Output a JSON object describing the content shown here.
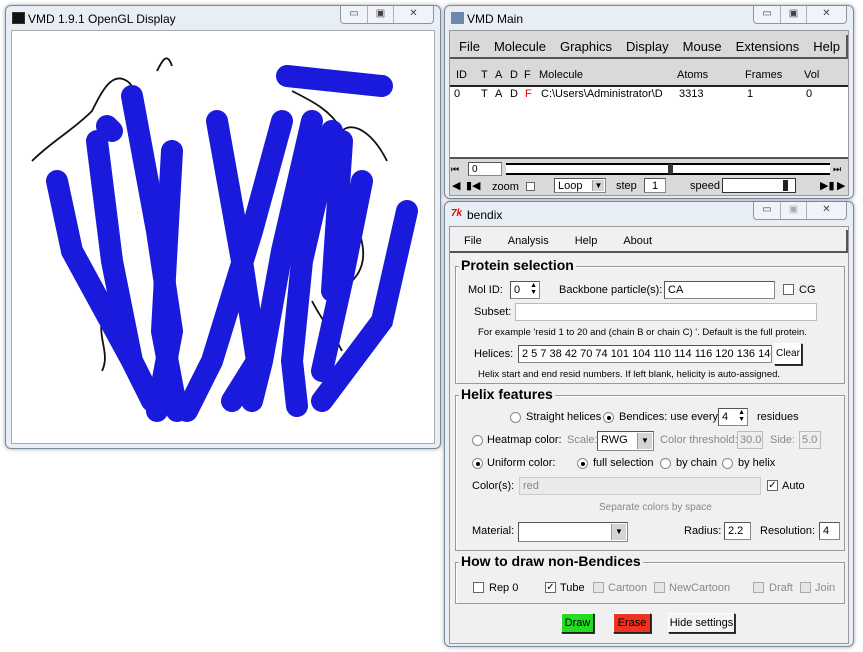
{
  "display_window": {
    "title": "VMD 1.9.1 OpenGL Display",
    "helix_color": "#1a1adc"
  },
  "main_window": {
    "title": "VMD Main",
    "menu": [
      "File",
      "Molecule",
      "Graphics",
      "Display",
      "Mouse",
      "Extensions",
      "Help"
    ],
    "columns": [
      "ID",
      "T",
      "A",
      "D",
      "F",
      "Molecule",
      "Atoms",
      "Frames",
      "Vol"
    ],
    "rows": [
      {
        "id": "0",
        "t": "T",
        "a": "A",
        "d": "D",
        "f": "F",
        "molecule": "C:\\Users\\Administrator\\D",
        "atoms": "3313",
        "frames": "1",
        "vol": "0"
      }
    ],
    "frame_value": "0",
    "zoom_label": "zoom",
    "loop_value": "Loop",
    "step_label": "step",
    "step_value": "1",
    "speed_label": "speed",
    "speed_level": 0.9
  },
  "bendix": {
    "title": "bendix",
    "menu": [
      "File",
      "Analysis",
      "Help",
      "About"
    ],
    "protein_selection": {
      "legend": "Protein selection",
      "molid_label": "Mol ID:",
      "molid_value": "0",
      "backbone_label": "Backbone particle(s):",
      "backbone_value": "CA",
      "cg_label": "CG",
      "subset_label": "Subset:",
      "subset_value": "",
      "subset_hint": "For example 'resid 1 to 20 and (chain B or chain C) '. Default is the full protein.",
      "helices_label": "Helices:",
      "helices_value": "2 5 7 38 42 70 74 101 104 110 114 116 120 136 140 1",
      "clear_label": "Clear",
      "helices_hint": "Helix start and end resid numbers. If left blank, helicity is auto-assigned."
    },
    "helix_features": {
      "legend": "Helix features",
      "straight_label": "Straight helices",
      "bendices_label": "Bendices: use every",
      "bendices_value": "4",
      "residues_label": "residues",
      "heatmap_label": "Heatmap color:",
      "scale_label": "Scale:",
      "scale_value": "RWG",
      "threshold_label": "Color threshold:",
      "threshold_value": "30.0",
      "side_label": "Side:",
      "side_value": "5.0",
      "uniform_label": "Uniform color:",
      "full_label": "full selection",
      "chain_label": "by chain",
      "helix_label": "by helix",
      "colors_label": "Color(s):",
      "colors_value": "red",
      "auto_label": "Auto",
      "colors_hint": "Separate colors by space",
      "material_label": "Material:",
      "material_value": "",
      "radius_label": "Radius:",
      "radius_value": "2.2",
      "resolution_label": "Resolution:",
      "resolution_value": "4"
    },
    "non_bendices": {
      "legend": "How to draw non-Bendices",
      "options": [
        "Rep 0",
        "Tube",
        "Cartoon",
        "NewCartoon",
        "Draft",
        "Join"
      ]
    },
    "buttons": {
      "draw": "Draw",
      "erase": "Erase",
      "hide": "Hide settings"
    },
    "colors": {
      "draw": "#22dd22",
      "erase": "#ee3322"
    }
  }
}
